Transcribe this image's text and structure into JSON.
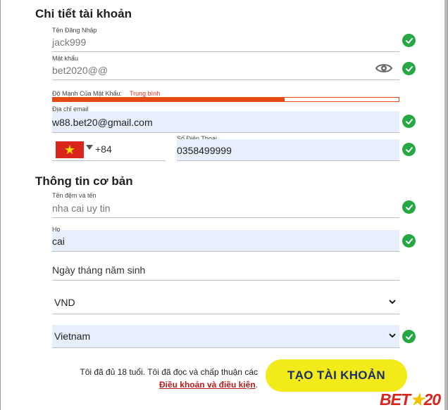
{
  "account_section": {
    "title": "Chi tiết tài khoản"
  },
  "username": {
    "label": "Tên Đăng Nhập",
    "value": "jack999"
  },
  "password": {
    "label": "Mật khẩu",
    "value": "bet2020@@"
  },
  "password_strength": {
    "label": "Độ Mạnh Của Mật Khẩu:",
    "value": "Trung bình",
    "level": 0.67,
    "color": "#e44b12"
  },
  "email": {
    "label": "Địa chỉ email",
    "value": "w88.bet20@gmail.com"
  },
  "phone": {
    "dial_code": "+84",
    "label": "Số Điện Thoại",
    "value": "0358499999",
    "flag_icon": "vietnam-flag-icon"
  },
  "basic_section": {
    "title": "Thông tin cơ bản"
  },
  "given_name": {
    "label": "Tên đệm và tên",
    "value": "nha cai uy tin"
  },
  "surname": {
    "label": "Họ",
    "value": "cai"
  },
  "birthdate": {
    "placeholder": "Ngày tháng năm sinh"
  },
  "currency": {
    "value": "VND"
  },
  "country": {
    "value": "Vietnam"
  },
  "terms": {
    "text": "Tôi đã đủ 18 tuổi. Tôi đã đọc và chấp thuận các",
    "link": "Điều khoản và điều kiện",
    "suffix": "."
  },
  "cta": {
    "label": "TẠO TÀI KHOẢN",
    "bg_color": "#f2ea19",
    "text_color": "#1d2d6b"
  },
  "logo": {
    "text_left": "BET",
    "star": "★",
    "text_right": "20"
  },
  "colors": {
    "check": "#27a845",
    "filled_bg": "#e8effc"
  }
}
